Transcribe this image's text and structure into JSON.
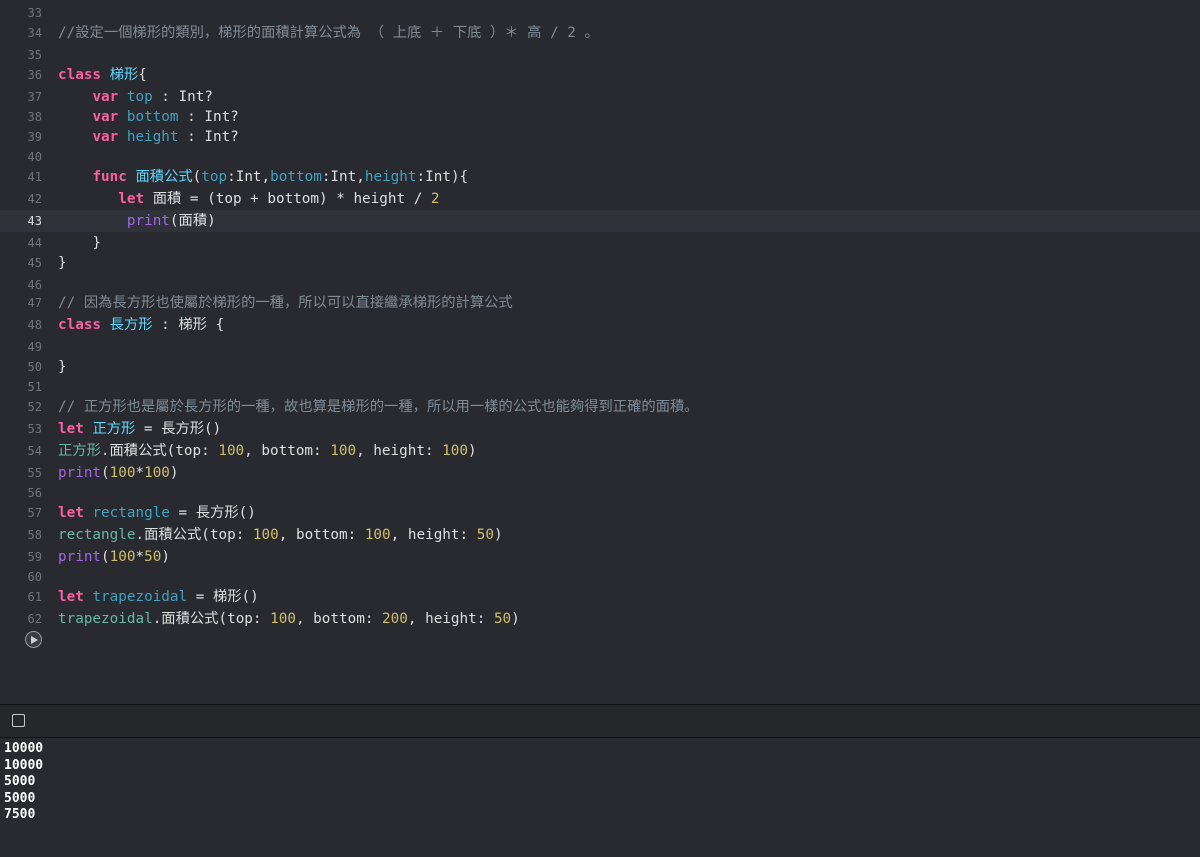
{
  "editor": {
    "lines": [
      {
        "n": "33",
        "tokens": []
      },
      {
        "n": "34",
        "tokens": [
          {
            "t": "//設定一個梯形的類別，梯形的面積計算公式為 （ 上底 ＋ 下底 ）＊ 高 / 2 。",
            "c": "cmt"
          }
        ]
      },
      {
        "n": "35",
        "tokens": []
      },
      {
        "n": "36",
        "tokens": [
          {
            "t": "class",
            "c": "kw"
          },
          {
            "t": " "
          },
          {
            "t": "梯形",
            "c": "decl"
          },
          {
            "t": "{"
          }
        ]
      },
      {
        "n": "37",
        "tokens": [
          {
            "t": "    "
          },
          {
            "t": "var",
            "c": "kw"
          },
          {
            "t": " "
          },
          {
            "t": "top",
            "c": "decl2"
          },
          {
            "t": " : Int?"
          }
        ]
      },
      {
        "n": "38",
        "tokens": [
          {
            "t": "    "
          },
          {
            "t": "var",
            "c": "kw"
          },
          {
            "t": " "
          },
          {
            "t": "bottom",
            "c": "decl2"
          },
          {
            "t": " : Int?"
          }
        ]
      },
      {
        "n": "39",
        "tokens": [
          {
            "t": "    "
          },
          {
            "t": "var",
            "c": "kw"
          },
          {
            "t": " "
          },
          {
            "t": "height",
            "c": "decl2"
          },
          {
            "t": " : Int?"
          }
        ]
      },
      {
        "n": "40",
        "tokens": []
      },
      {
        "n": "41",
        "tokens": [
          {
            "t": "    "
          },
          {
            "t": "func",
            "c": "kw"
          },
          {
            "t": " "
          },
          {
            "t": "面積公式",
            "c": "decl"
          },
          {
            "t": "("
          },
          {
            "t": "top",
            "c": "decl2"
          },
          {
            "t": ":Int,"
          },
          {
            "t": "bottom",
            "c": "decl2"
          },
          {
            "t": ":Int,"
          },
          {
            "t": "height",
            "c": "decl2"
          },
          {
            "t": ":Int){"
          }
        ]
      },
      {
        "n": "42",
        "tokens": [
          {
            "t": "       "
          },
          {
            "t": "let",
            "c": "kw"
          },
          {
            "t": " 面積 = (top + bottom) * height / "
          },
          {
            "t": "2",
            "c": "num"
          }
        ]
      },
      {
        "n": "43",
        "tokens": [
          {
            "t": "        "
          },
          {
            "t": "print",
            "c": "sys"
          },
          {
            "t": "(面積)"
          }
        ],
        "current": true
      },
      {
        "n": "44",
        "tokens": [
          {
            "t": "    }"
          }
        ]
      },
      {
        "n": "45",
        "tokens": [
          {
            "t": "}"
          }
        ]
      },
      {
        "n": "46",
        "tokens": []
      },
      {
        "n": "47",
        "tokens": [
          {
            "t": "// 因為長方形也使屬於梯形的一種，所以可以直接繼承梯形的計算公式",
            "c": "cmt"
          }
        ]
      },
      {
        "n": "48",
        "tokens": [
          {
            "t": "class",
            "c": "kw"
          },
          {
            "t": " "
          },
          {
            "t": "長方形",
            "c": "decl"
          },
          {
            "t": " : 梯形 {"
          }
        ]
      },
      {
        "n": "49",
        "tokens": []
      },
      {
        "n": "50",
        "tokens": [
          {
            "t": "}"
          }
        ]
      },
      {
        "n": "51",
        "tokens": []
      },
      {
        "n": "52",
        "tokens": [
          {
            "t": "// 正方形也是屬於長方形的一種，故也算是梯形的一種，所以用一樣的公式也能夠得到正確的面積。",
            "c": "cmt"
          }
        ]
      },
      {
        "n": "53",
        "tokens": [
          {
            "t": "let",
            "c": "kw"
          },
          {
            "t": " "
          },
          {
            "t": "正方形",
            "c": "decl"
          },
          {
            "t": " = 長方形()"
          }
        ]
      },
      {
        "n": "54",
        "tokens": [
          {
            "t": "正方形",
            "c": "fn"
          },
          {
            "t": ".面積公式(top: "
          },
          {
            "t": "100",
            "c": "num"
          },
          {
            "t": ", bottom: "
          },
          {
            "t": "100",
            "c": "num"
          },
          {
            "t": ", height: "
          },
          {
            "t": "100",
            "c": "num"
          },
          {
            "t": ")"
          }
        ]
      },
      {
        "n": "55",
        "tokens": [
          {
            "t": "print",
            "c": "sys"
          },
          {
            "t": "("
          },
          {
            "t": "100",
            "c": "num"
          },
          {
            "t": "*"
          },
          {
            "t": "100",
            "c": "num"
          },
          {
            "t": ")"
          }
        ]
      },
      {
        "n": "56",
        "tokens": []
      },
      {
        "n": "57",
        "tokens": [
          {
            "t": "let",
            "c": "kw"
          },
          {
            "t": " "
          },
          {
            "t": "rectangle",
            "c": "decl2"
          },
          {
            "t": " = 長方形()"
          }
        ]
      },
      {
        "n": "58",
        "tokens": [
          {
            "t": "rectangle",
            "c": "fn"
          },
          {
            "t": ".面積公式(top: "
          },
          {
            "t": "100",
            "c": "num"
          },
          {
            "t": ", bottom: "
          },
          {
            "t": "100",
            "c": "num"
          },
          {
            "t": ", height: "
          },
          {
            "t": "50",
            "c": "num"
          },
          {
            "t": ")"
          }
        ]
      },
      {
        "n": "59",
        "tokens": [
          {
            "t": "print",
            "c": "sys"
          },
          {
            "t": "("
          },
          {
            "t": "100",
            "c": "num"
          },
          {
            "t": "*"
          },
          {
            "t": "50",
            "c": "num"
          },
          {
            "t": ")"
          }
        ]
      },
      {
        "n": "60",
        "tokens": []
      },
      {
        "n": "61",
        "tokens": [
          {
            "t": "let",
            "c": "kw"
          },
          {
            "t": " "
          },
          {
            "t": "trapezoidal",
            "c": "decl2"
          },
          {
            "t": " = 梯形()"
          }
        ]
      },
      {
        "n": "62",
        "tokens": [
          {
            "t": "trapezoidal",
            "c": "fn"
          },
          {
            "t": ".面積公式(top: "
          },
          {
            "t": "100",
            "c": "num"
          },
          {
            "t": ", bottom: "
          },
          {
            "t": "200",
            "c": "num"
          },
          {
            "t": ", height: "
          },
          {
            "t": "50",
            "c": "num"
          },
          {
            "t": ")"
          }
        ]
      }
    ]
  },
  "run_button": {
    "icon": "play-icon"
  },
  "debug_bar": {
    "console_toggle_icon": "square-icon"
  },
  "console": {
    "output": [
      "10000",
      "10000",
      "5000",
      "5000",
      "7500"
    ]
  },
  "colors": {
    "background": "#292a30",
    "keyword": "#fc5fa3",
    "declaration": "#5dd8ff",
    "number": "#d0bf69",
    "comment": "#7f8c98",
    "system_function": "#a167e6"
  }
}
